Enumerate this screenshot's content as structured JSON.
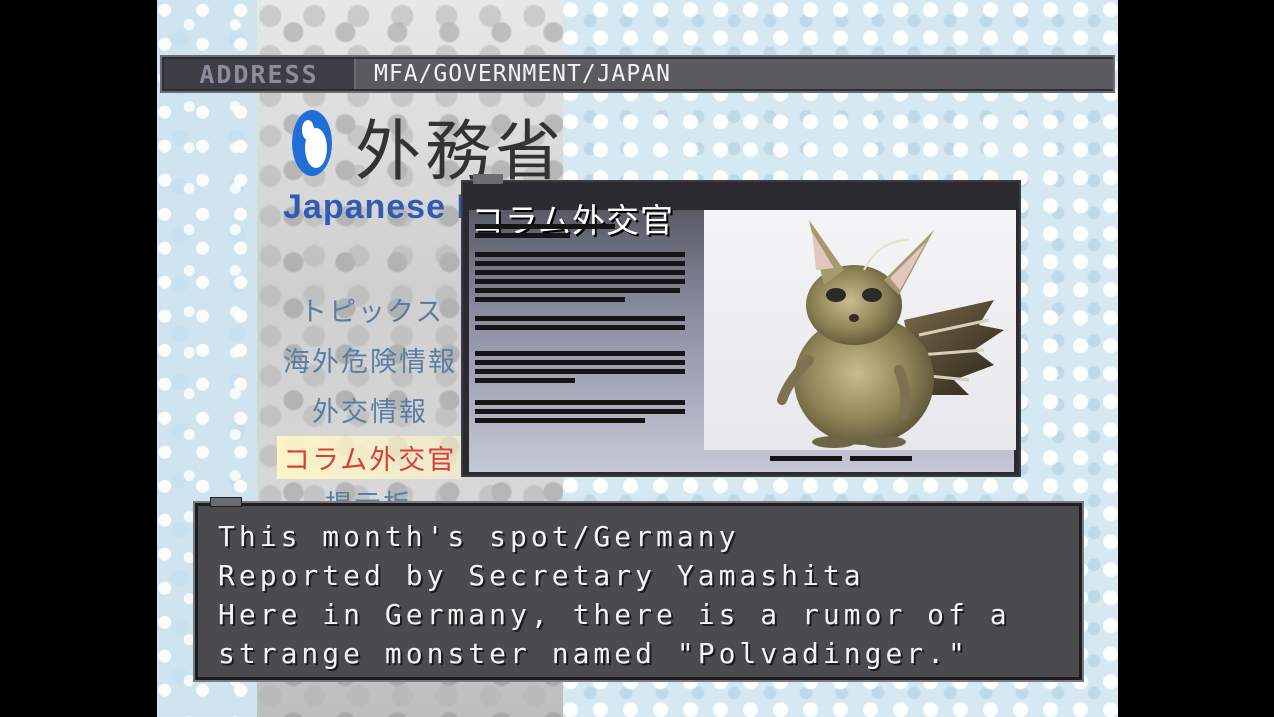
{
  "address_bar": {
    "label": "ADDRESS",
    "url": "MFA/GOVERNMENT/JAPAN"
  },
  "site": {
    "logo_kanji": "外務省",
    "logo_roman": "Japanese I"
  },
  "nav": {
    "items": [
      {
        "label": "トピックス"
      },
      {
        "label": "海外危険情報"
      },
      {
        "label": "外交情報"
      },
      {
        "label": "コラム外交官",
        "selected": true
      },
      {
        "label": "掲示板"
      }
    ]
  },
  "popup": {
    "title": "コラム外交官"
  },
  "dialogue": {
    "lines": [
      "This month's spot/Germany",
      "Reported by Secretary Yamashita",
      "Here in Germany, there is a rumor of a",
      "strange monster named \"Polvadinger.\""
    ]
  },
  "colors": {
    "window_frame": "#2a2a30",
    "dialogue_bg": "#4a4a4f",
    "nav_text": "#5c7da3",
    "nav_selected_text": "#d64232",
    "logo_blue": "#2f5bb5"
  }
}
